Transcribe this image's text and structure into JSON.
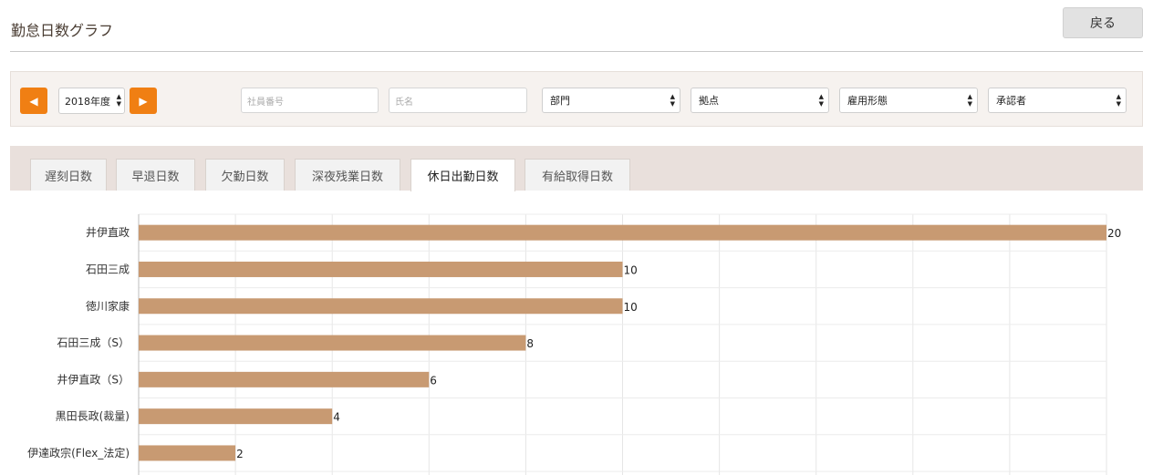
{
  "header": {
    "title": "勤怠日数グラフ",
    "back_label": "戻る"
  },
  "filters": {
    "prev_icon": "◀",
    "next_icon": "▶",
    "year_value": "2018年度",
    "employee_no_placeholder": "社員番号",
    "name_placeholder": "氏名",
    "department": "部門",
    "location": "拠点",
    "employment_type": "雇用形態",
    "approver": "承認者"
  },
  "tabs": [
    {
      "label": "遅刻日数",
      "active": false
    },
    {
      "label": "早退日数",
      "active": false
    },
    {
      "label": "欠勤日数",
      "active": false
    },
    {
      "label": "深夜残業日数",
      "active": false
    },
    {
      "label": "休日出勤日数",
      "active": true
    },
    {
      "label": "有給取得日数",
      "active": false
    }
  ],
  "chart_data": {
    "type": "bar",
    "orientation": "horizontal",
    "categories": [
      "井伊直政",
      "石田三成",
      "徳川家康",
      "石田三成（S）",
      "井伊直政（S）",
      "黒田長政(裁量)",
      "伊達政宗(Flex_法定)"
    ],
    "values": [
      20,
      10,
      10,
      8,
      6,
      4,
      2
    ],
    "xlim": [
      0,
      20
    ],
    "grid": true,
    "bar_color": "#c89a72",
    "value_labels": [
      "20",
      "10",
      "10",
      "8",
      "6",
      "4",
      "2"
    ]
  }
}
